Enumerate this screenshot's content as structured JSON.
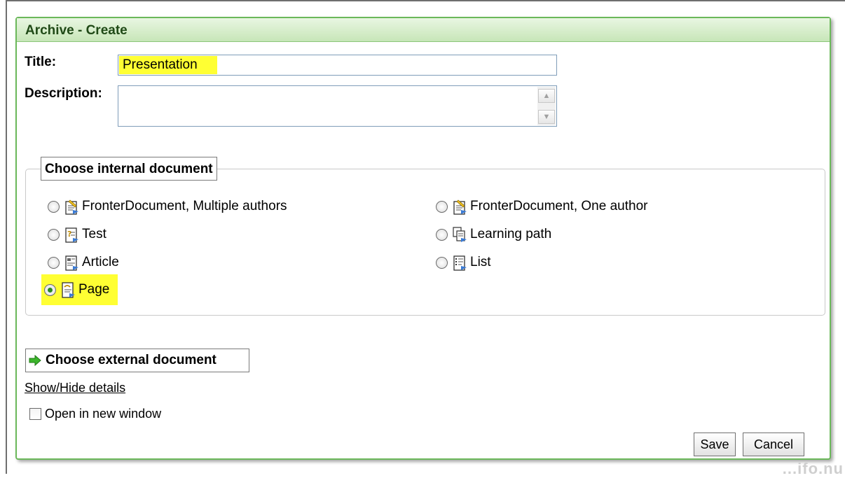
{
  "panel": {
    "title": "Archive - Create"
  },
  "form": {
    "title_label": "Title:",
    "title_value": "Presentation",
    "description_label": "Description:",
    "description_value": ""
  },
  "internal": {
    "legend": "Choose internal document",
    "options": [
      {
        "label": "FronterDocument, Multiple authors",
        "icon": "fronter-document-icon",
        "checked": false
      },
      {
        "label": "FronterDocument, One author",
        "icon": "fronter-document-icon",
        "checked": false
      },
      {
        "label": "Test",
        "icon": "test-document-icon",
        "checked": false
      },
      {
        "label": "Learning path",
        "icon": "learning-path-icon",
        "checked": false
      },
      {
        "label": "Article",
        "icon": "article-document-icon",
        "checked": false
      },
      {
        "label": "List",
        "icon": "list-document-icon",
        "checked": false
      },
      {
        "label": "Page",
        "icon": "page-document-icon",
        "checked": true
      }
    ]
  },
  "external": {
    "label": "Choose external document",
    "icon": "green-arrow-icon"
  },
  "details_link": "Show/Hide details",
  "open_new_window": {
    "label": "Open in new window",
    "checked": false
  },
  "buttons": {
    "save": "Save",
    "cancel": "Cancel"
  },
  "watermark": "...ifo.nu",
  "colors": {
    "highlight": "#ffff33",
    "panel_border": "#6bb85a",
    "header_text": "#204a17"
  }
}
